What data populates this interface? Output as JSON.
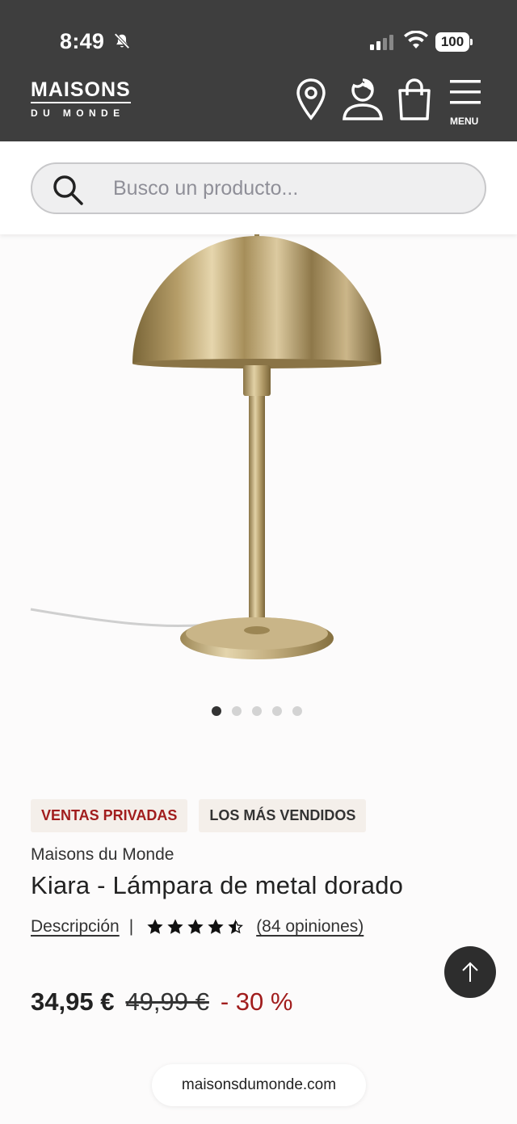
{
  "status_bar": {
    "time": "8:49",
    "battery": "100"
  },
  "header": {
    "logo_top": "MAISONS",
    "logo_bottom": "DU MONDE",
    "menu_label": "MENU",
    "icons": [
      "location-pin-icon",
      "account-icon",
      "shopping-bag-icon",
      "menu-icon"
    ]
  },
  "search": {
    "placeholder": "Busco un producto..."
  },
  "gallery": {
    "total_images": 5,
    "active_index": 0
  },
  "product": {
    "badges": [
      "VENTAS PRIVADAS",
      "LOS MÁS VENDIDOS"
    ],
    "brand": "Maisons du Monde",
    "title": "Kiara - Lámpara de metal dorado",
    "description_link": "Descripción",
    "separator": "|",
    "rating": 4.5,
    "reviews": "(84 opiniones)",
    "price_now": "34,95 €",
    "price_old": "49,99 €",
    "discount": "- 30 %"
  },
  "browser": {
    "url": "maisonsdumonde.com"
  },
  "colors": {
    "header_bg": "#3e3e3e",
    "accent_red": "#a11d1d",
    "badge_bg": "#f4efea"
  }
}
